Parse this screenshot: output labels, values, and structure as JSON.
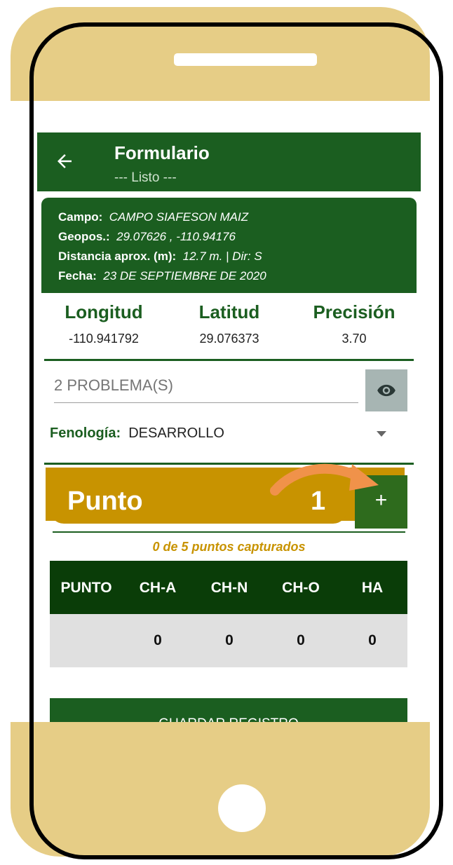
{
  "app_bar": {
    "title": "Formulario",
    "subtitle": "--- Listo ---"
  },
  "info": {
    "campo_label": "Campo:",
    "campo_value": "CAMPO SIAFESON MAIZ",
    "geopos_label": "Geopos.:",
    "geopos_value": "29.07626 , -110.94176",
    "distancia_label": "Distancia aprox. (m):",
    "distancia_value": "12.7 m. | Dir: S",
    "fecha_label": "Fecha:",
    "fecha_value": "23 DE SEPTIEMBRE DE 2020"
  },
  "coords": {
    "longitud_label": "Longitud",
    "longitud_value": "-110.941792",
    "latitud_label": "Latitud",
    "latitud_value": "29.076373",
    "precision_label": "Precisión",
    "precision_value": "3.70"
  },
  "problems": {
    "placeholder": "2 PROBLEMA(S)"
  },
  "fenologia": {
    "label": "Fenología:",
    "value": "DESARROLLO"
  },
  "punto": {
    "label": "Punto",
    "number": "1",
    "add_label": "+"
  },
  "captured_text": "0 de 5 puntos capturados",
  "table": {
    "headers": [
      "PUNTO",
      "CH-A",
      "CH-N",
      "CH-O",
      "HA"
    ],
    "rows": [
      [
        "",
        "0",
        "0",
        "0",
        "0"
      ]
    ]
  },
  "save_button": "GUARDAR REGISTRO",
  "colors": {
    "primary_green": "#1b5e20",
    "dark_green": "#0a3d08",
    "gold": "#c89300",
    "phone_beige": "#e6cd86",
    "arrow_orange": "#f0924a"
  },
  "icons": [
    "back-arrow-icon",
    "eye-icon",
    "dropdown-caret-icon",
    "plus-icon",
    "pointer-arrow-icon"
  ]
}
